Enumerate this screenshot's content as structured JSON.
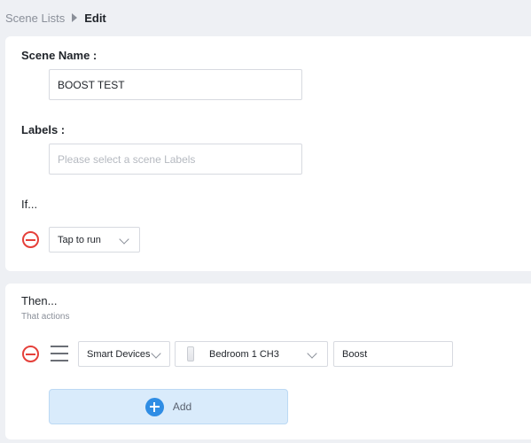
{
  "breadcrumb": {
    "parent": "Scene Lists",
    "current": "Edit"
  },
  "form": {
    "scene_name_label": "Scene Name :",
    "scene_name_value": "BOOST TEST",
    "labels_label": "Labels :",
    "labels_placeholder": "Please select a scene Labels",
    "if_label": "If...",
    "condition_value": "Tap to run"
  },
  "actions": {
    "then_label": "Then...",
    "subtitle": "That actions",
    "rows": [
      {
        "type": "Smart Devices",
        "device": "Bedroom 1 CH3",
        "action": "Boost"
      }
    ],
    "add_label": "Add"
  },
  "icons": {
    "remove": "minus-circle-icon",
    "drag": "drag-handle-icon",
    "add": "plus-circle-icon",
    "chevron": "chevron-down-icon",
    "breadcrumb_separator": "triangle-right-icon"
  },
  "colors": {
    "remove": "#e5403a",
    "add_button_bg": "#d9ebfb",
    "add_icon": "#2f8de4",
    "page_bg": "#eef0f4"
  }
}
